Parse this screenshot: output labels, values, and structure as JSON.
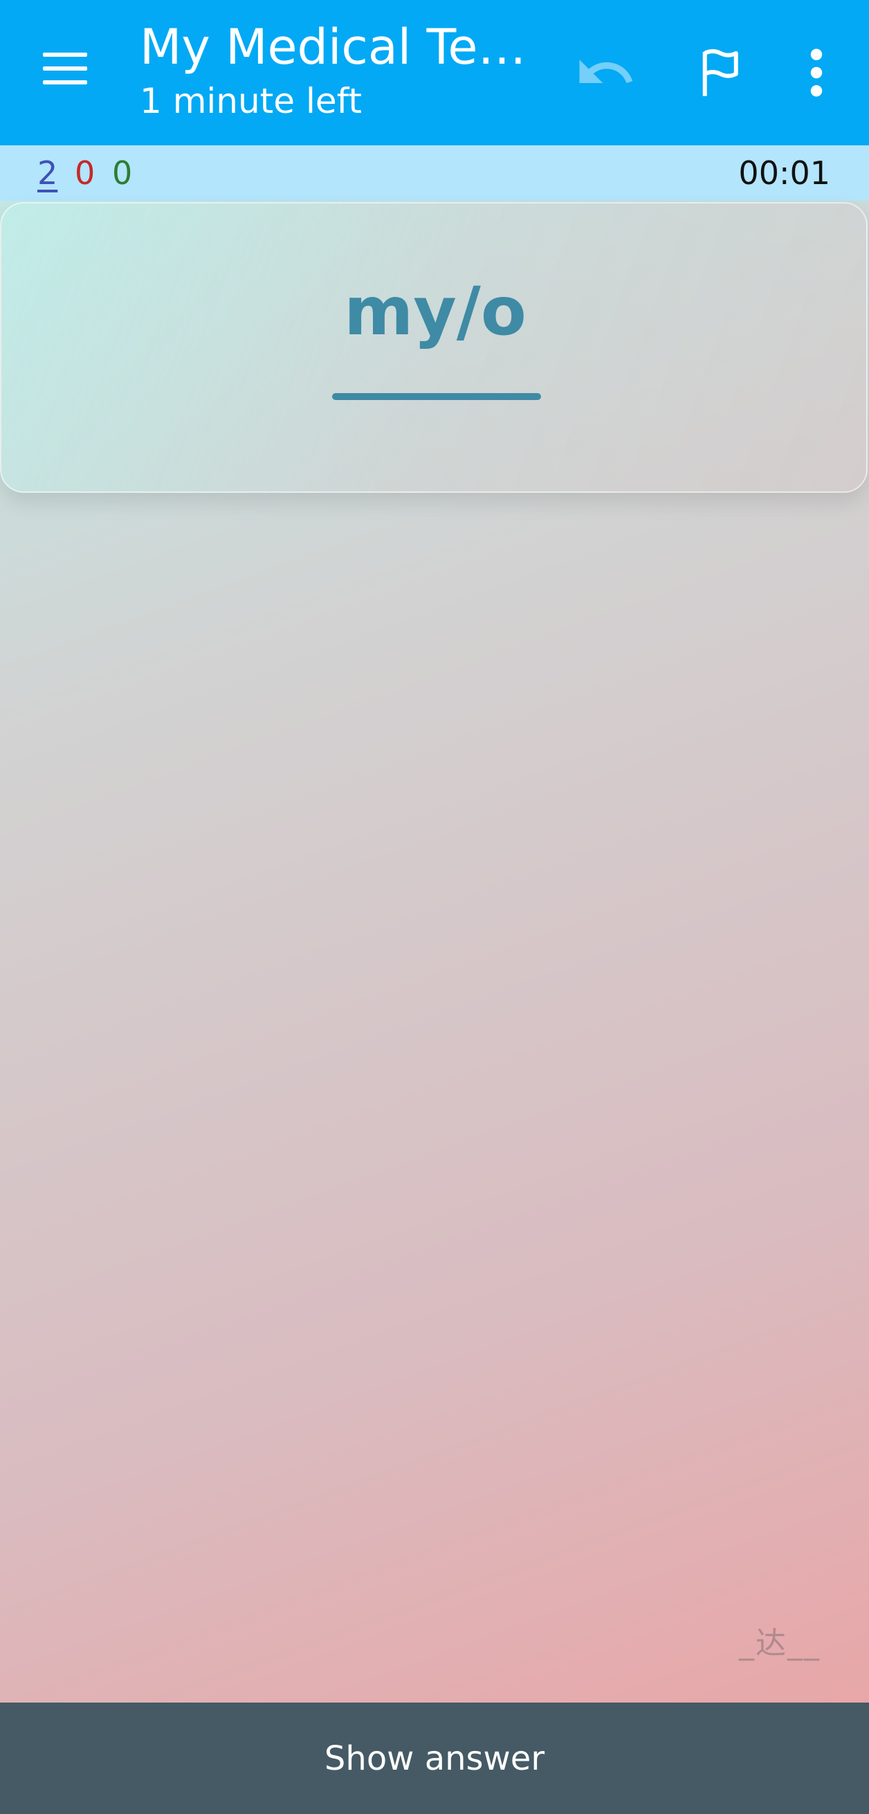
{
  "app_bar": {
    "title": "My Medical Ter…",
    "subtitle": "1 minute left",
    "menu_icon": "hamburger-menu-icon",
    "undo_icon": "undo-icon",
    "flag_icon": "flag-icon",
    "more_icon": "more-vert-icon",
    "background_color": "#03a9f4"
  },
  "counts": {
    "new": "2",
    "learning": "0",
    "review": "0",
    "timer": "00:01",
    "colors": {
      "new": "#3f51b5",
      "learning": "#c62828",
      "review": "#2e7d32"
    }
  },
  "card": {
    "front_text": "my/o",
    "text_color": "#3f8aa5"
  },
  "watermark": "_达__",
  "footer": {
    "show_answer_label": "Show answer",
    "background_color": "#455a64"
  }
}
